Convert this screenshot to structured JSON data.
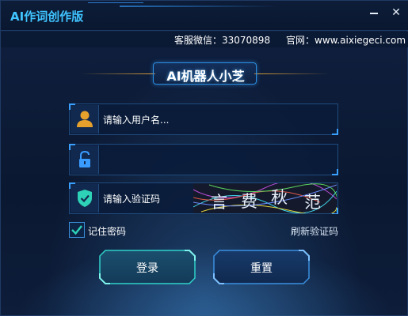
{
  "app": {
    "title": "AI作词创作版"
  },
  "window_controls": {
    "minimize": "minimize",
    "close": "✕"
  },
  "info": {
    "service": "客服微信：33070898",
    "website": "官网：www.aixiegeci.com"
  },
  "banner": {
    "title": "AI机器人小芝"
  },
  "form": {
    "username_placeholder": "请输入用户名...",
    "password_value": "",
    "captcha_placeholder": "请输入验证码",
    "captcha_chars": [
      "言",
      "费",
      "秋",
      "范"
    ],
    "remember_label": "记住密码",
    "remember_checked": true,
    "refresh_label": "刷新验证码"
  },
  "buttons": {
    "login": "登录",
    "reset": "重置"
  },
  "icons": {
    "user": "user-icon",
    "lock": "lock-icon",
    "shield": "shield-check-icon",
    "check": "checkmark-icon"
  },
  "colors": {
    "accent": "#3fc4ff",
    "login_border": "#2fd1c9",
    "reset_border": "#3a8fe0",
    "icon_orange": "#e6a02c",
    "icon_blue": "#3a9bff",
    "icon_green": "#2ed3b7",
    "banner_line": "#e2a43a"
  }
}
